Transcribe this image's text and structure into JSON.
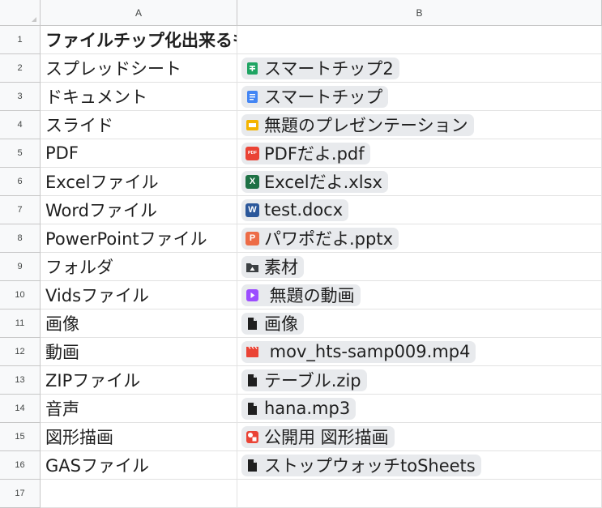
{
  "columns": [
    "A",
    "B"
  ],
  "rows": [
    {
      "num": "1",
      "a": "ファイルチップ化出来るもの",
      "a_bold": true,
      "b": "",
      "icon": "",
      "icon_name": ""
    },
    {
      "num": "2",
      "a": "スプレッドシート",
      "b": "スマートチップ2",
      "icon": "sheets",
      "icon_name": "sheets-icon"
    },
    {
      "num": "3",
      "a": "ドキュメント",
      "b": "スマートチップ",
      "icon": "docs",
      "icon_name": "docs-icon"
    },
    {
      "num": "4",
      "a": "スライド",
      "b": "無題のプレゼンテーション",
      "icon": "slides",
      "icon_name": "slides-icon"
    },
    {
      "num": "5",
      "a": "PDF",
      "b": "PDFだよ.pdf",
      "icon": "pdf",
      "icon_name": "pdf-icon"
    },
    {
      "num": "6",
      "a": "Excelファイル",
      "b": "Excelだよ.xlsx",
      "icon": "excel",
      "icon_name": "excel-icon"
    },
    {
      "num": "7",
      "a": "Wordファイル",
      "b": "test.docx",
      "icon": "word",
      "icon_name": "word-icon"
    },
    {
      "num": "8",
      "a": "PowerPointファイル",
      "b": "パワポだよ.pptx",
      "icon": "ppt",
      "icon_name": "powerpoint-icon"
    },
    {
      "num": "9",
      "a": "フォルダ",
      "b": "素材",
      "icon": "folder",
      "icon_name": "shared-folder-icon"
    },
    {
      "num": "10",
      "a": "Vidsファイル",
      "b": " 無題の動画",
      "icon": "vids",
      "icon_name": "vids-icon"
    },
    {
      "num": "11",
      "a": "画像",
      "b": "画像",
      "icon": "file",
      "icon_name": "file-icon"
    },
    {
      "num": "12",
      "a": "動画",
      "b": " mov_hts-samp009.mp4",
      "icon": "video",
      "icon_name": "video-icon"
    },
    {
      "num": "13",
      "a": "ZIPファイル",
      "b": "テーブル.zip",
      "icon": "file",
      "icon_name": "file-icon"
    },
    {
      "num": "14",
      "a": "音声",
      "b": "hana.mp3",
      "icon": "file",
      "icon_name": "file-icon"
    },
    {
      "num": "15",
      "a": "図形描画",
      "b": "公開用 図形描画",
      "icon": "drawing",
      "icon_name": "drawing-icon"
    },
    {
      "num": "16",
      "a": "GASファイル",
      "b": "ストップウォッチtoSheets",
      "icon": "file",
      "icon_name": "file-icon"
    },
    {
      "num": "17",
      "a": "",
      "b": "",
      "icon": "",
      "icon_name": ""
    }
  ],
  "colors": {
    "sheets": "#1fa463",
    "docs": "#4285f4",
    "slides": "#f4b400",
    "pdf": "#ea4335",
    "excel": "#1e7145",
    "word": "#2b579a",
    "ppt": "#ed6c47",
    "vids": "#9c4dff",
    "video": "#ea4335",
    "drawing": "#ea4335"
  },
  "icon_glyphs": {
    "pdf": "PDF",
    "excel": "X",
    "word": "W",
    "ppt": "P"
  }
}
